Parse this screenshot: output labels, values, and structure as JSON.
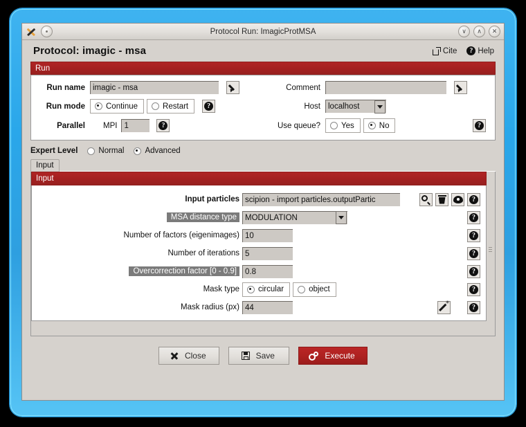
{
  "window": {
    "title": "Protocol Run: ImagicProtMSA",
    "app_icon": "scipion-x-icon",
    "menu_dot_icon": "window-menu-icon",
    "minimize_glyph": "∨",
    "maximize_glyph": "∧",
    "close_glyph": "✕"
  },
  "header": {
    "title": "Protocol: imagic - msa",
    "cite_label": "Cite",
    "help_label": "Help"
  },
  "run_section": {
    "heading": "Run",
    "run_name_label": "Run name",
    "run_name_value": "imagic - msa",
    "comment_label": "Comment",
    "comment_value": "",
    "run_mode_label": "Run mode",
    "run_mode_options": [
      "Continue",
      "Restart"
    ],
    "run_mode_selected": "Continue",
    "host_label": "Host",
    "host_value": "localhost",
    "parallel_label": "Parallel",
    "mpi_label": "MPI",
    "mpi_value": "1",
    "use_queue_label": "Use queue?",
    "use_queue_options": [
      "Yes",
      "No"
    ],
    "use_queue_selected": "No",
    "help_glyph": "?"
  },
  "expert": {
    "label": "Expert Level",
    "options": [
      "Normal",
      "Advanced"
    ],
    "selected": "Advanced"
  },
  "tabs": [
    {
      "label": "Input",
      "active": true
    }
  ],
  "input_section": {
    "heading": "Input",
    "fields": [
      {
        "label": "Input particles",
        "value": "scipion - import particles.outputPartic",
        "type": "text",
        "label_bold": true,
        "label_highlight": false,
        "actions": [
          "search-icon",
          "trash-icon",
          "eye-icon",
          "help-icon"
        ]
      },
      {
        "label": "MSA distance type",
        "value": "MODULATION",
        "type": "combo",
        "label_bold": false,
        "label_highlight": true,
        "actions": [
          "help-icon"
        ]
      },
      {
        "label": "Number of factors (eigenimages)",
        "value": "10",
        "type": "text",
        "label_bold": false,
        "label_highlight": false,
        "actions": [
          "help-icon"
        ]
      },
      {
        "label": "Number of iterations",
        "value": "5",
        "type": "text",
        "label_bold": false,
        "label_highlight": false,
        "actions": [
          "help-icon"
        ]
      },
      {
        "label": "Overcorrection factor [0 - 0.9]",
        "value": "0.8",
        "type": "text",
        "label_bold": false,
        "label_highlight": true,
        "actions": [
          "help-icon"
        ]
      },
      {
        "label": "Mask type",
        "value": "circular",
        "type": "radio",
        "options": [
          "circular",
          "object"
        ],
        "label_bold": false,
        "label_highlight": false,
        "actions": [
          "help-icon"
        ]
      },
      {
        "label": "Mask radius (px)",
        "value": "44",
        "type": "text",
        "label_bold": false,
        "label_highlight": false,
        "actions": [
          "wand-icon",
          "help-icon"
        ]
      }
    ]
  },
  "footer": {
    "close_label": "Close",
    "save_label": "Save",
    "execute_label": "Execute"
  },
  "colors": {
    "section_red": "#a32020",
    "execute_red": "#ad2120",
    "window_bg": "#d6d2cd",
    "field_bg": "#cdc9c4",
    "highlight_bg": "#7b7b7b",
    "wm_blue": "#2aa7ea"
  }
}
